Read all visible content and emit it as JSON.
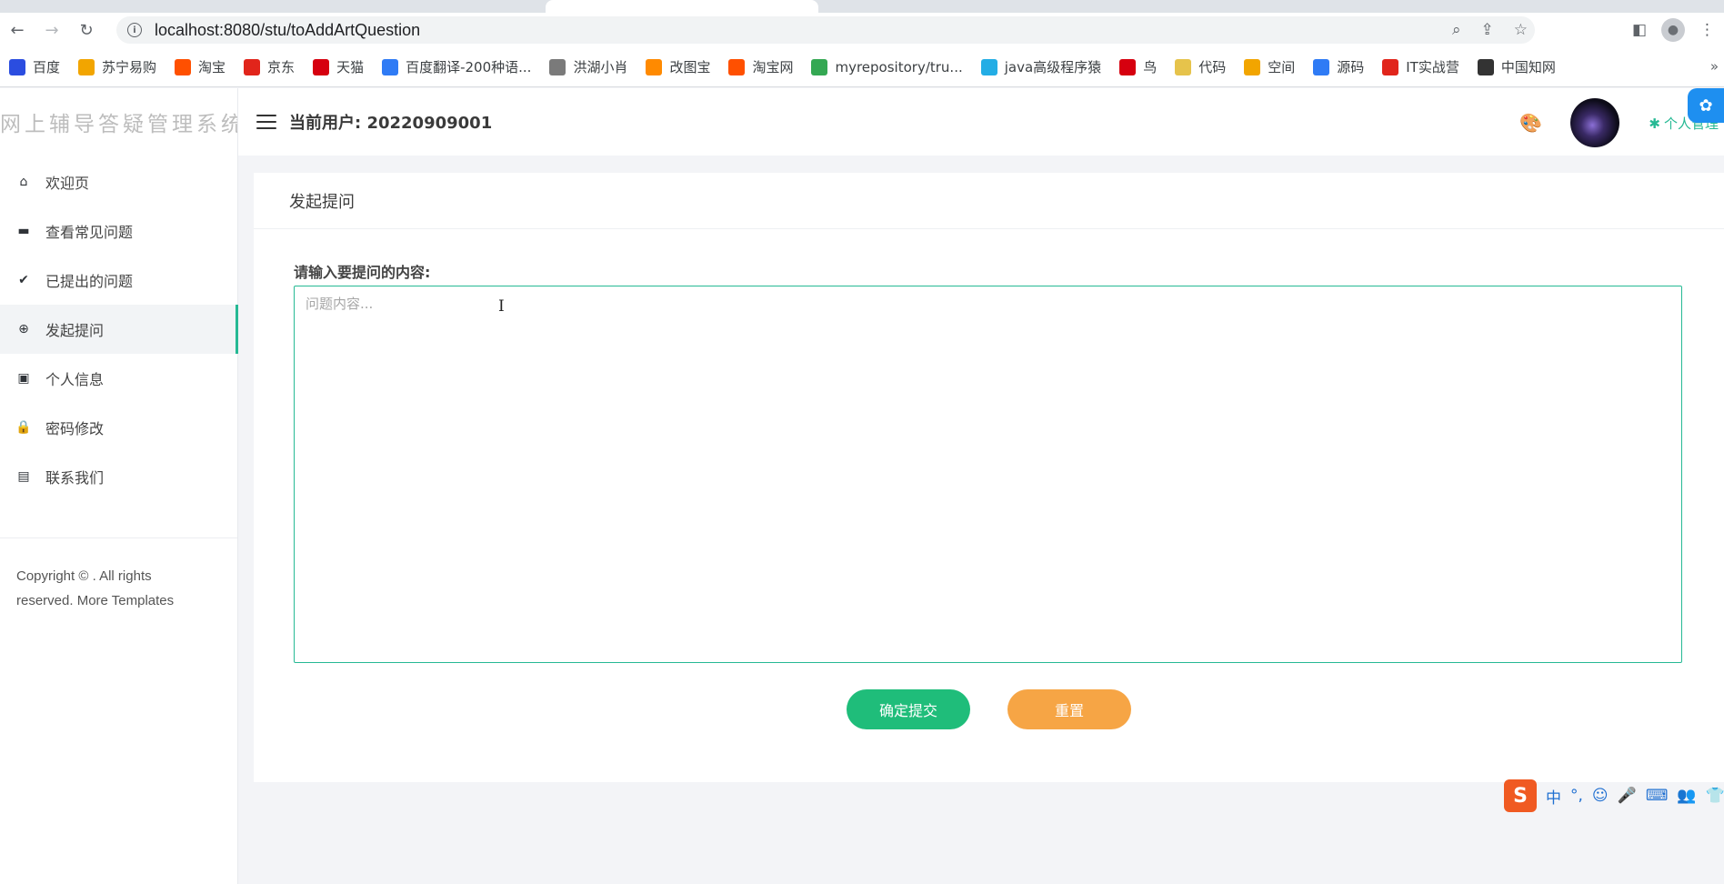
{
  "browser": {
    "url": "localhost:8080/stu/toAddArtQuestion",
    "bookmarks": [
      {
        "label": "百度",
        "icon": "baidu-icon",
        "color": "#2b4de0"
      },
      {
        "label": "苏宁易购",
        "icon": "suning-icon",
        "color": "#f2a500"
      },
      {
        "label": "淘宝",
        "icon": "taobao-icon",
        "color": "#ff5000"
      },
      {
        "label": "京东",
        "icon": "jd-icon",
        "color": "#e1251b"
      },
      {
        "label": "天猫",
        "icon": "tmall-icon",
        "color": "#d6000f"
      },
      {
        "label": "百度翻译-200种语...",
        "icon": "translate-icon",
        "color": "#2f7bf5"
      },
      {
        "label": "洪湖小肖",
        "icon": "bird-icon",
        "color": "#7a7a7a"
      },
      {
        "label": "改图宝",
        "icon": "image-tool-icon",
        "color": "#ff8a00"
      },
      {
        "label": "淘宝网",
        "icon": "taobao-icon",
        "color": "#ff5000"
      },
      {
        "label": "myrepository/tru...",
        "icon": "chrome-icon",
        "color": "#34a853"
      },
      {
        "label": "java高级程序猿",
        "icon": "bilibili-icon",
        "color": "#23ade5"
      },
      {
        "label": "鸟",
        "icon": "bird-icon",
        "color": "#d6000f"
      },
      {
        "label": "代码",
        "icon": "code-icon",
        "color": "#e6c34b"
      },
      {
        "label": "空间",
        "icon": "space-icon",
        "color": "#f2a500"
      },
      {
        "label": "源码",
        "icon": "fish-icon",
        "color": "#2f7bf5"
      },
      {
        "label": "IT实战营",
        "icon": "it-icon",
        "color": "#e1251b"
      },
      {
        "label": "中国知网",
        "icon": "cnki-icon",
        "color": "#333333"
      }
    ],
    "more": "»"
  },
  "sidebar": {
    "logo_text": "网上辅导答疑管理系统",
    "items": [
      {
        "label": "欢迎页",
        "icon": "home-icon",
        "glyph": "⌂"
      },
      {
        "label": "查看常见问题",
        "icon": "comment-icon",
        "glyph": "▬"
      },
      {
        "label": "已提出的问题",
        "icon": "check-square-icon",
        "glyph": "✔"
      },
      {
        "label": "发起提问",
        "icon": "plus-circle-icon",
        "glyph": "⊕"
      },
      {
        "label": "个人信息",
        "icon": "id-card-icon",
        "glyph": "▣"
      },
      {
        "label": "密码修改",
        "icon": "lock-icon",
        "glyph": "🔒"
      },
      {
        "label": "联系我们",
        "icon": "address-book-icon",
        "glyph": "▤"
      }
    ],
    "active_index": 3,
    "copyright_line1": "Copyright © . All rights",
    "copyright_line2": "reserved. More Templates"
  },
  "topbar": {
    "current_user": "当前用户: 20220909001",
    "personal_menu": "个人管理"
  },
  "main": {
    "card_title": "发起提问",
    "field_label": "请输入要提问的内容:",
    "textarea_placeholder": "问题内容...",
    "textarea_value": "",
    "submit_label": "确定提交",
    "reset_label": "重置"
  },
  "colors": {
    "accent": "#26b994",
    "submit": "#1fbd7a",
    "reset": "#f6a545"
  },
  "ime": {
    "lang": "中",
    "punct": "°,"
  }
}
